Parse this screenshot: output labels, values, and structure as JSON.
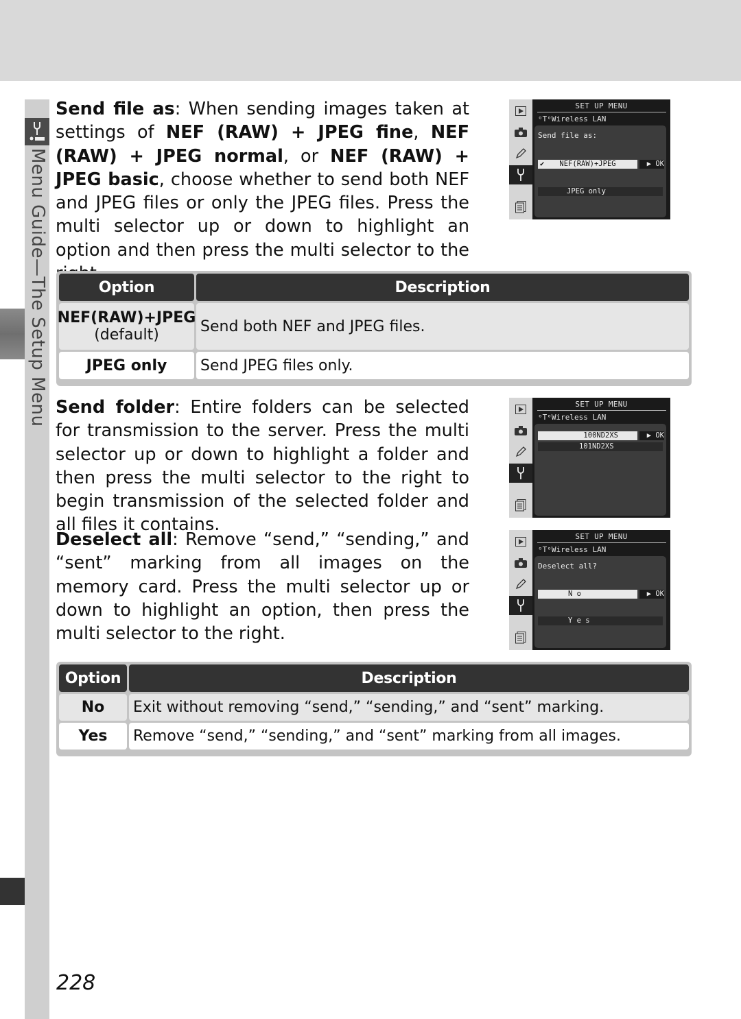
{
  "page": {
    "number": "228",
    "side_label": "Menu Guide—The Setup Menu"
  },
  "sections": {
    "send_file_as": {
      "term": "Send file as",
      "sep": ": When sending images taken at set­tings of ",
      "b1": "NEF (RAW) + JPEG fine",
      "t1": ", ",
      "b2": "NEF (RAW) + JPEG normal",
      "t2": ", or ",
      "b3": "NEF (RAW) + JPEG basic",
      "t3": ", choose whether to send both NEF and JPEG files or only the JPEG files.  Press the multi selector up or down to highlight an option and then press the multi selector to the right."
    },
    "send_folder": {
      "term": "Send folder",
      "text": ": Entire folders can be selected for transmission to the server.  Press the multi selector up or down to highlight a folder and then press the multi selector to the right to begin transmis­sion of the selected folder and all files it contains."
    },
    "deselect_all": {
      "term": "Deselect all",
      "text": ": Remove “send,” “sending,” and “sent” marking from all images on the memory card.  Press the multi selector up or down to high­light an option, then press the multi selector to the right."
    }
  },
  "screens": [
    {
      "header": "SET UP MENU",
      "sub": "ᵒTᵒWireless LAN",
      "prompt": "Send file as:",
      "selected": "NEF(RAW)+JPEG",
      "check": "✔",
      "ok": "▶ OK",
      "other": "JPEG only"
    },
    {
      "header": "SET UP MENU",
      "sub": "ᵒTᵒWireless LAN",
      "prompt": "",
      "selected": "100ND2XS",
      "ok": "▶ OK",
      "other": "101ND2XS"
    },
    {
      "header": "SET UP MENU",
      "sub": "ᵒTᵒWireless LAN",
      "prompt": "Deselect all?",
      "selected": "N o",
      "ok": "▶ OK",
      "other": "Y e s"
    }
  ],
  "table1": {
    "headers": [
      "Option",
      "Description"
    ],
    "rows": [
      {
        "option": "NEF(RAW)+JPEG",
        "note": "(default)",
        "description": "Send both NEF and JPEG files."
      },
      {
        "option": "JPEG only",
        "description": "Send JPEG files only."
      }
    ]
  },
  "table2": {
    "headers": [
      "Option",
      "Description"
    ],
    "rows": [
      {
        "option": "No",
        "description": "Exit without removing “send,” “sending,” and “sent” marking."
      },
      {
        "option": "Yes",
        "description": "Remove “send,” “sending,” and “sent” marking from all images."
      }
    ]
  }
}
